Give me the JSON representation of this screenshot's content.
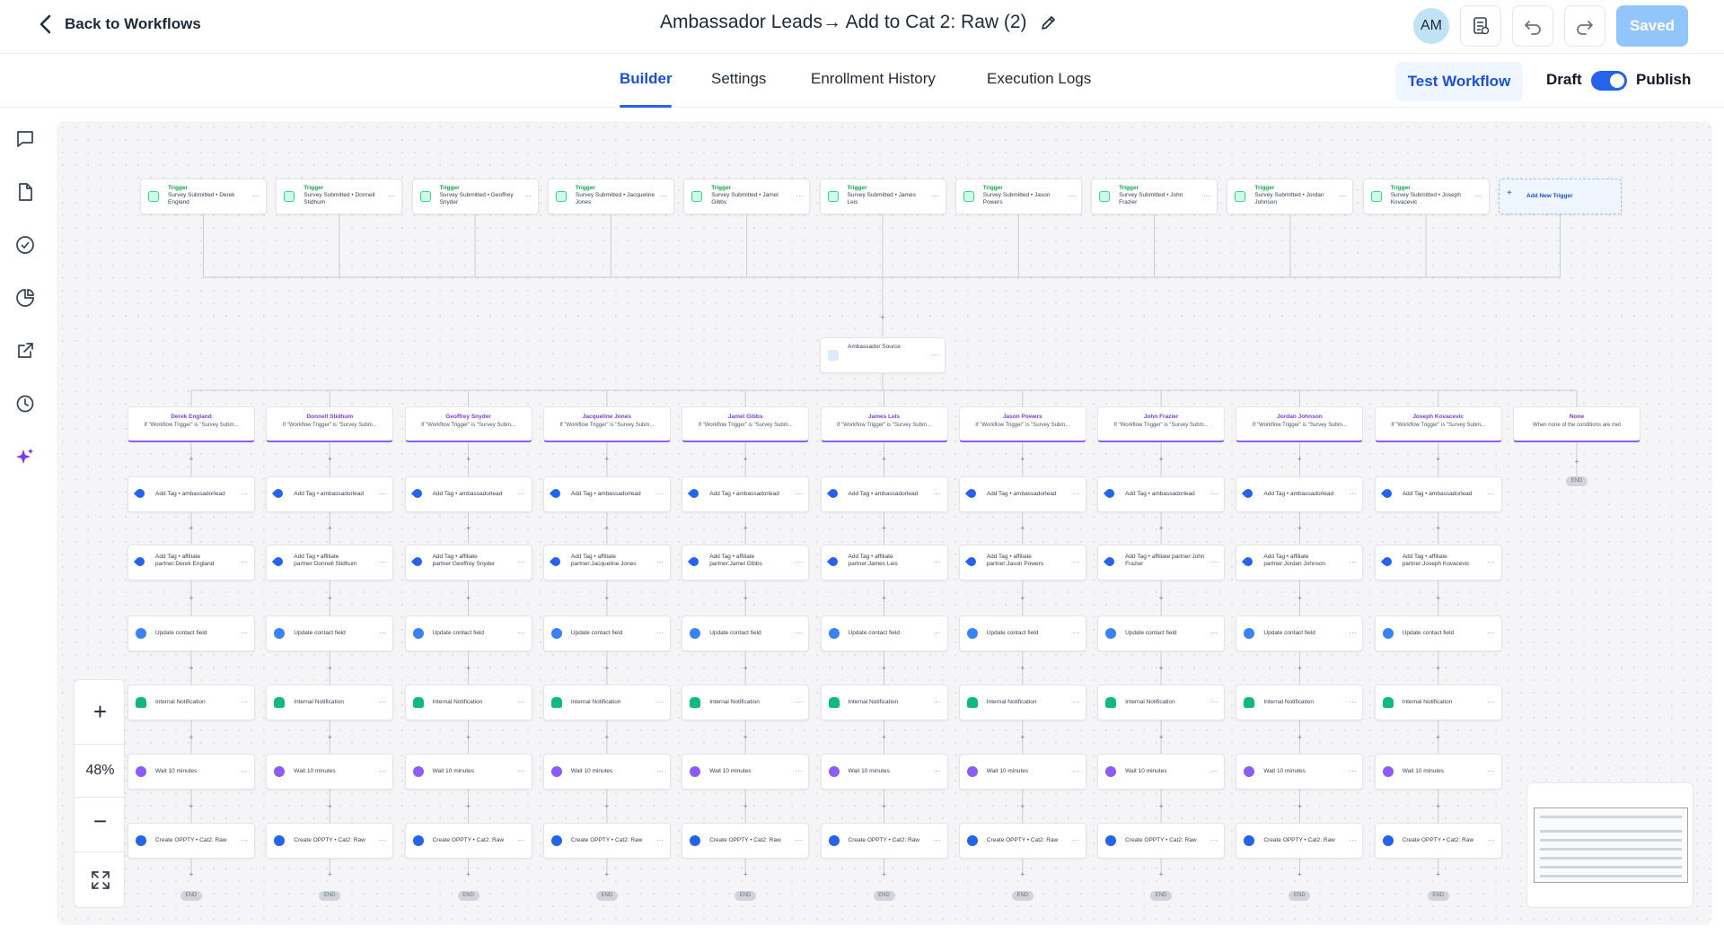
{
  "header": {
    "back_label": "Back to Workflows",
    "title": "Ambassador Leads→ Add to Cat 2: Raw (2)",
    "avatar_initials": "AM",
    "saved_label": "Saved"
  },
  "tabs": [
    {
      "label": "Builder",
      "active": true
    },
    {
      "label": "Settings",
      "active": false
    },
    {
      "label": "Enrollment History",
      "active": false
    },
    {
      "label": "Execution Logs",
      "active": false
    }
  ],
  "actions": {
    "test_workflow": "Test Workflow",
    "draft_label": "Draft",
    "publish_label": "Publish",
    "publish_toggle_on": true
  },
  "zoom": {
    "plus": "+",
    "level": "48%",
    "minus": "−"
  },
  "rail_icons": [
    "chat-icon",
    "file-icon",
    "check-circle-icon",
    "pie-chart-icon",
    "external-link-icon",
    "history-icon",
    "ai-sparkle-icon"
  ],
  "workflow": {
    "trigger_title": "Trigger",
    "triggers": [
      "Survey Submitted • Derek England",
      "Survey Submitted • Donnell Stidhum",
      "Survey Submitted • Geoffrey Snyder",
      "Survey Submitted • Jacqueline Jones",
      "Survey Submitted • Jamel Gibbs",
      "Survey Submitted • James Leis",
      "Survey Submitted • Jason Powers",
      "Survey Submitted • John Frazier",
      "Survey Submitted • Jordan Johnson",
      "Survey Submitted • Joseph Kovacevic"
    ],
    "add_trigger": "Add New Trigger",
    "source_node": "Ambassador Source",
    "branches": [
      {
        "name": "Derek England",
        "cond": "If \"Workflow Trigger\" is \"Survey Subm...",
        "tag": "Add Tag • affiliate partner:Derek England"
      },
      {
        "name": "Donnell Stidhum",
        "cond": "If \"Workflow Trigger\" is \"Survey Subm...",
        "tag": "Add Tag • affiliate partner:Donnell Stidhum"
      },
      {
        "name": "Geoffrey Snyder",
        "cond": "If \"Workflow Trigger\" is \"Survey Subm...",
        "tag": "Add Tag • affiliate partner:Geoffrey Snyder"
      },
      {
        "name": "Jacqueline Jones",
        "cond": "If \"Workflow Trigger\" is \"Survey Subm...",
        "tag": "Add Tag • affiliate partner:Jacqueline Jones"
      },
      {
        "name": "Jamel Gibbs",
        "cond": "If \"Workflow Trigger\" is \"Survey Subm...",
        "tag": "Add Tag • affiliate partner:Jamel Gibbs"
      },
      {
        "name": "James Leis",
        "cond": "If \"Workflow Trigger\" is \"Survey Subm...",
        "tag": "Add Tag • affiliate partner:James Leis"
      },
      {
        "name": "Jason Powers",
        "cond": "If \"Workflow Trigger\" is \"Survey Subm...",
        "tag": "Add Tag • affiliate partner:Jason Powers"
      },
      {
        "name": "John Frazier",
        "cond": "If \"Workflow Trigger\" is \"Survey Subm...",
        "tag": "Add Tag • affiliate partner:John Frazier"
      },
      {
        "name": "Jordan Johnson",
        "cond": "If \"Workflow Trigger\" is \"Survey Subm...",
        "tag": "Add Tag • affiliate partner:Jordan Johnson"
      },
      {
        "name": "Joseph Kovacevic",
        "cond": "If \"Workflow Trigger\" is \"Survey Subm...",
        "tag": "Add Tag • affiliate partner:Joseph Kovacevic"
      }
    ],
    "none_branch": {
      "name": "None",
      "cond": "When none of the conditions are met"
    },
    "steps": {
      "tag_lead": "Add Tag • ambassadorlead",
      "update": "Update contact field",
      "notif": "Internal Notification",
      "wait": "Wait 10 minutes",
      "opp": "Create OPPTY • Cat2: Raw"
    },
    "end_label": "END"
  }
}
